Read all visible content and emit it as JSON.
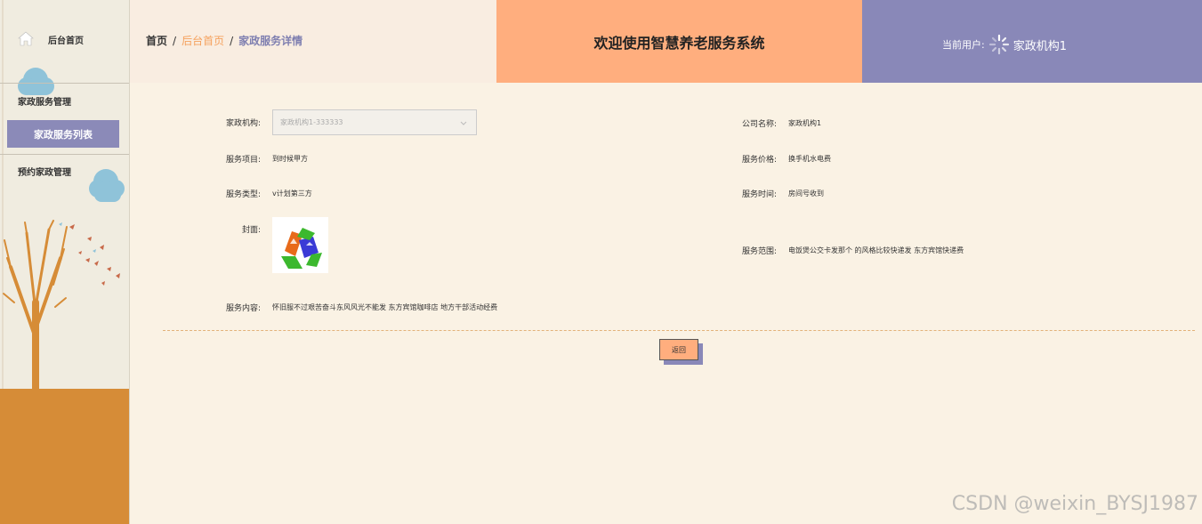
{
  "sidebar": {
    "home_label": "后台首页",
    "group_label": "家政服务管理",
    "active_item": "家政服务列表",
    "group2_label": "预约家政管理"
  },
  "breadcrumb": {
    "home": "首页",
    "separator": "/",
    "middle": "后台首页",
    "current": "家政服务详情"
  },
  "header": {
    "title": "欢迎使用智慧养老服务系统",
    "user_label": "当前用户:",
    "user_name": "家政机构1"
  },
  "form": {
    "institution_label": "家政机构:",
    "institution_value": "家政机构1-333333",
    "company_label": "公司名称:",
    "company_value": "家政机构1",
    "item_label": "服务项目:",
    "item_value": "到时候甲方",
    "price_label": "服务价格:",
    "price_value": "换手机水电费",
    "type_label": "服务类型:",
    "type_value": "v计划第三方",
    "time_label": "服务时间:",
    "time_value": "房间号收到",
    "cover_label": "封面:",
    "range_label": "服务范围:",
    "range_value": "电饭煲公交卡发那个 的风格比较快递发 东方宾馆快递费",
    "content_label": "服务内容:",
    "content_value": "怀旧服不过艰苦奋斗东风风光不能发 东方宾馆咖啡店 地方干部活动经费"
  },
  "back_button": "返回",
  "watermark": "CSDN @weixin_BYSJ1987",
  "colors": {
    "sidebar_bg": "#f0ece0",
    "ground": "#d68c37",
    "active_menu": "#8b8ab8",
    "header_orange": "#ffae7e",
    "header_purple": "#8988b8",
    "page_bg": "#faf2e4",
    "breadcrumb_accent": "#f5a15d"
  }
}
